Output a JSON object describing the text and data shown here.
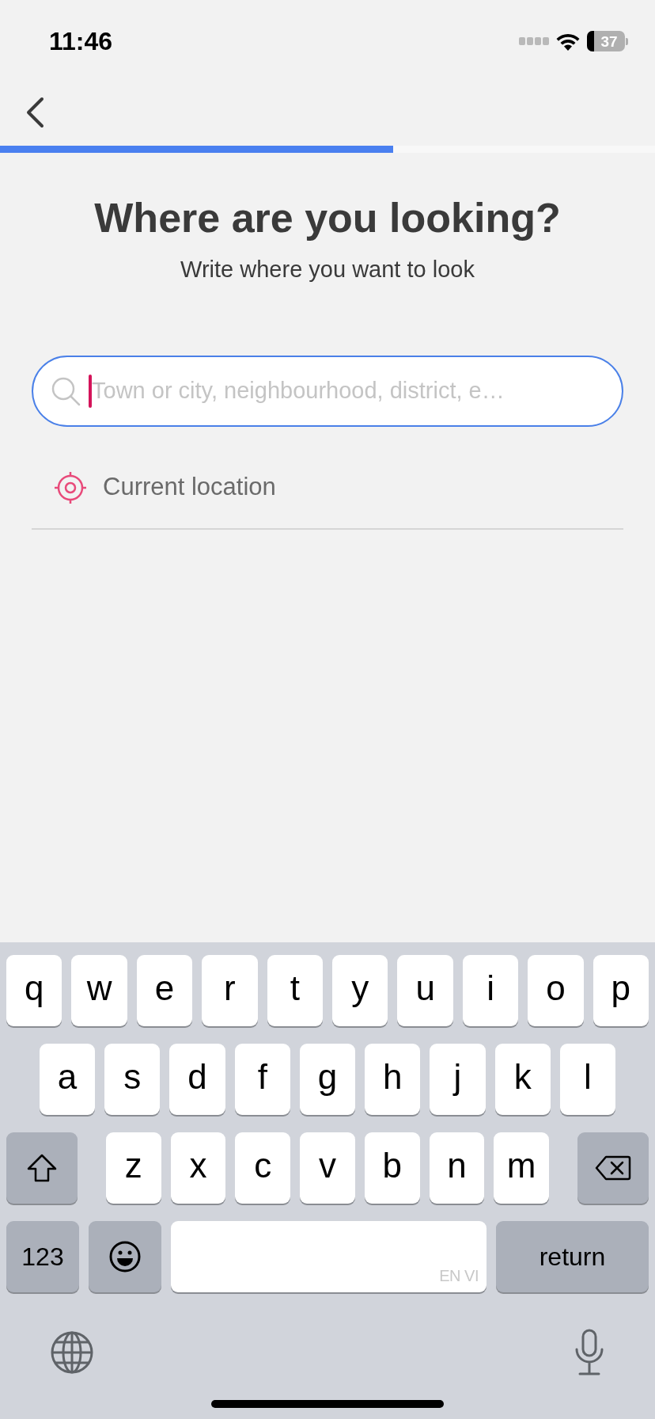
{
  "status_bar": {
    "time": "11:46",
    "battery": "37"
  },
  "progress": {
    "level": 0.6
  },
  "title": "Where are you looking?",
  "subtitle": "Write where you want to look",
  "search": {
    "placeholder": "Town or city, neighbourhood, district, e…"
  },
  "current_location": {
    "label": "Current location"
  },
  "keyboard": {
    "rows": [
      [
        "q",
        "w",
        "e",
        "r",
        "t",
        "y",
        "u",
        "i",
        "o",
        "p"
      ],
      [
        "a",
        "s",
        "d",
        "f",
        "g",
        "h",
        "j",
        "k",
        "l"
      ],
      [
        "z",
        "x",
        "c",
        "v",
        "b",
        "n",
        "m"
      ]
    ],
    "numbers_key": "123",
    "space_languages": "EN VI",
    "return_key": "return"
  }
}
